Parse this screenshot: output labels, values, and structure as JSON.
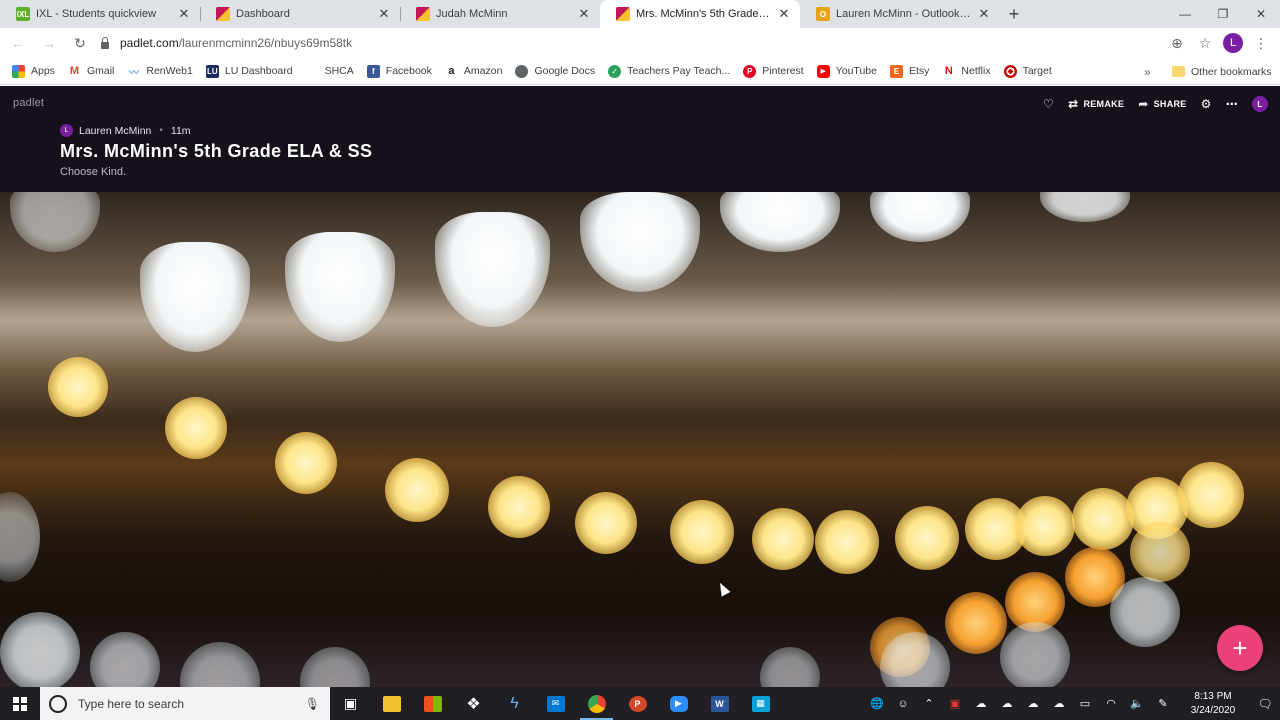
{
  "tabs": [
    {
      "title": "IXL - Students quickview",
      "favicon_color": "#5fae2e",
      "favicon_text": "IXL",
      "active": false
    },
    {
      "title": "Dashboard",
      "favicon_color": "#c2185b",
      "favicon_text": "",
      "active": false
    },
    {
      "title": "Judah McMinn",
      "favicon_color": "#c2185b",
      "favicon_text": "",
      "active": false
    },
    {
      "title": "Mrs. McMinn's 5th Grade ELA &",
      "favicon_color": "#c2185b",
      "favicon_text": "",
      "active": true
    },
    {
      "title": "Lauren McMinn - Outlook Web A",
      "favicon_color": "#e8a317",
      "favicon_text": "O",
      "active": false
    }
  ],
  "toolbar": {
    "url_host": "padlet.com",
    "url_path": "/laurenmcminn26/nbuys69m58tk",
    "profile_initial": "L"
  },
  "bookmarks": [
    {
      "label": "Apps",
      "icon": "apps-grid-icon",
      "color": "#4285f4"
    },
    {
      "label": "Gmail",
      "icon": "gmail-icon",
      "color": "#ea4335"
    },
    {
      "label": "RenWeb1",
      "icon": "renweb-icon",
      "color": "#6aa0d6"
    },
    {
      "label": "LU Dashboard",
      "icon": "lu-icon",
      "color": "#1a2b5e"
    },
    {
      "label": "SHCA",
      "icon": "shca-icon",
      "color": "#ffffff"
    },
    {
      "label": "Facebook",
      "icon": "facebook-icon",
      "color": "#3b5998"
    },
    {
      "label": "Amazon",
      "icon": "amazon-icon",
      "color": "#222222"
    },
    {
      "label": "Google Docs",
      "icon": "globe-icon",
      "color": "#5f6368"
    },
    {
      "label": "Teachers Pay Teach...",
      "icon": "tpt-icon",
      "color": "#2e9e5b"
    },
    {
      "label": "Pinterest",
      "icon": "pinterest-icon",
      "color": "#e60023"
    },
    {
      "label": "YouTube",
      "icon": "youtube-icon",
      "color": "#ff0000"
    },
    {
      "label": "Etsy",
      "icon": "etsy-icon",
      "color": "#f1641e"
    },
    {
      "label": "Netflix",
      "icon": "netflix-icon",
      "color": "#e50914"
    },
    {
      "label": "Target",
      "icon": "target-icon",
      "color": "#cc0000"
    }
  ],
  "bookmarks_more": "»",
  "other_bookmarks": "Other bookmarks",
  "padlet": {
    "logo": "padlet",
    "author": "Lauren McMinn",
    "author_initial": "L",
    "time_ago": "11m",
    "title": "Mrs. McMinn's 5th Grade ELA & SS",
    "description": "Choose Kind.",
    "remake_label": "REMAKE",
    "share_label": "SHARE",
    "user_initial": "L",
    "fab_label": "+"
  },
  "taskbar": {
    "search_placeholder": "Type here to search",
    "time": "8:13 PM",
    "date": "3/24/2020"
  },
  "colors": {
    "padlet_header_bg": "#15101a",
    "fab": "#ec407a",
    "avatar": "#7b1fa2"
  }
}
